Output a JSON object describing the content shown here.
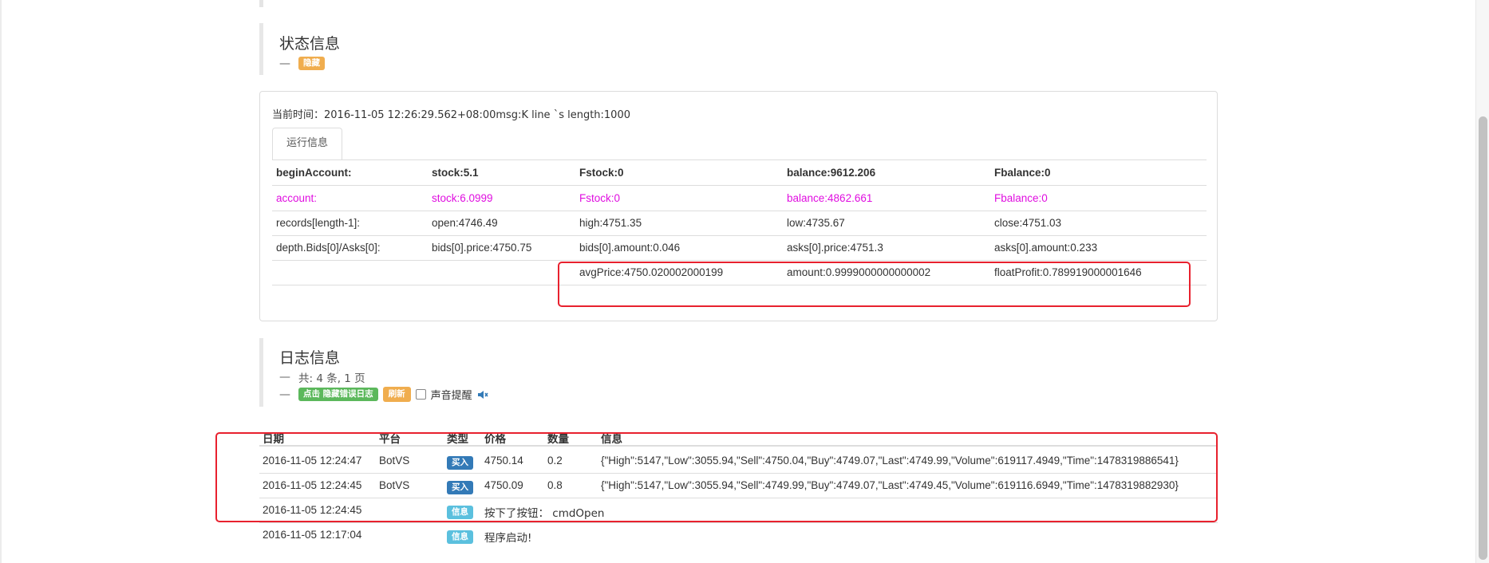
{
  "status_section": {
    "title": "状态信息",
    "toggle_label": "隐藏"
  },
  "status_panel": {
    "current_time_text": "当前时间：2016-11-05 12:26:29.562+08:00msg:K line `s length:1000",
    "tab_label": "运行信息",
    "rows": [
      [
        "beginAccount:",
        "stock:5.1",
        "Fstock:0",
        "balance:9612.206",
        "Fbalance:0"
      ],
      [
        "account:",
        "stock:6.0999",
        "Fstock:0",
        "balance:4862.661",
        "Fbalance:0"
      ],
      [
        "records[length-1]:",
        "open:4746.49",
        "high:4751.35",
        "low:4735.67",
        "close:4751.03"
      ],
      [
        "depth.Bids[0]/Asks[0]:",
        "bids[0].price:4750.75",
        "bids[0].amount:0.046",
        "asks[0].price:4751.3",
        "asks[0].amount:0.233"
      ],
      [
        "",
        "",
        "avgPrice:4750.020002000199",
        "amount:0.9999000000000002",
        "floatProfit:0.789919000001646"
      ]
    ],
    "highlight_color": "#e00ee0"
  },
  "log_section": {
    "title": "日志信息",
    "summary": "共: 4 条, 1 页",
    "hide_errors_label": "点击 隐藏错误日志",
    "refresh_label": "刷新",
    "sound_label": "声音提醒"
  },
  "log_table": {
    "headers": [
      "日期",
      "平台",
      "类型",
      "价格",
      "数量",
      "信息"
    ],
    "rows": [
      {
        "date": "2016-11-05 12:24:47",
        "platform": "BotVS",
        "type": "买入",
        "price": "4750.14",
        "amount": "0.2",
        "info": "{\"High\":5147,\"Low\":3055.94,\"Sell\":4750.04,\"Buy\":4749.07,\"Last\":4749.99,\"Volume\":619117.4949,\"Time\":1478319886541}"
      },
      {
        "date": "2016-11-05 12:24:45",
        "platform": "BotVS",
        "type": "买入",
        "price": "4750.09",
        "amount": "0.8",
        "info": "{\"High\":5147,\"Low\":3055.94,\"Sell\":4749.99,\"Buy\":4749.07,\"Last\":4749.45,\"Volume\":619116.6949,\"Time\":1478319882930}"
      },
      {
        "date": "2016-11-05 12:24:45",
        "platform": "",
        "type": "信息",
        "price": "按下了按钮： cmdOpen",
        "amount": "",
        "info": ""
      },
      {
        "date": "2016-11-05 12:17:04",
        "platform": "",
        "type": "信息",
        "price": "程序启动!",
        "amount": "",
        "info": ""
      }
    ]
  },
  "colors": {
    "label_orange": "#f0ad4e",
    "label_green": "#5cb85c",
    "label_buy": "#337ab7",
    "label_info": "#5bc0de",
    "annotation_red": "#e8212e"
  },
  "icons": {
    "sound": "speaker-icon"
  }
}
